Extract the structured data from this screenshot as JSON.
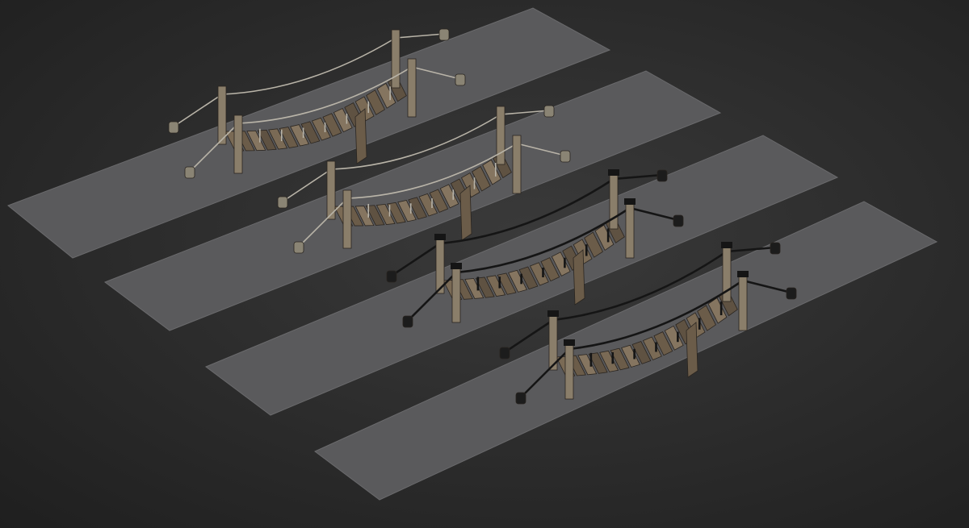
{
  "scene": {
    "background_color": "#2b2b2b",
    "slab_color": "#5a5a5c",
    "plank_colors": [
      "#7a6a55",
      "#6b5c49",
      "#857560",
      "#5f5242"
    ],
    "post_color": "#8a7e6a",
    "rope_light_color": "#b9b4a8",
    "rope_dark_color": "#151515",
    "bridges": [
      {
        "label": "",
        "rope_style": "light"
      },
      {
        "label": "",
        "rope_style": "light"
      },
      {
        "label": "",
        "rope_style": "dark"
      },
      {
        "label": "",
        "rope_style": "dark"
      }
    ]
  }
}
